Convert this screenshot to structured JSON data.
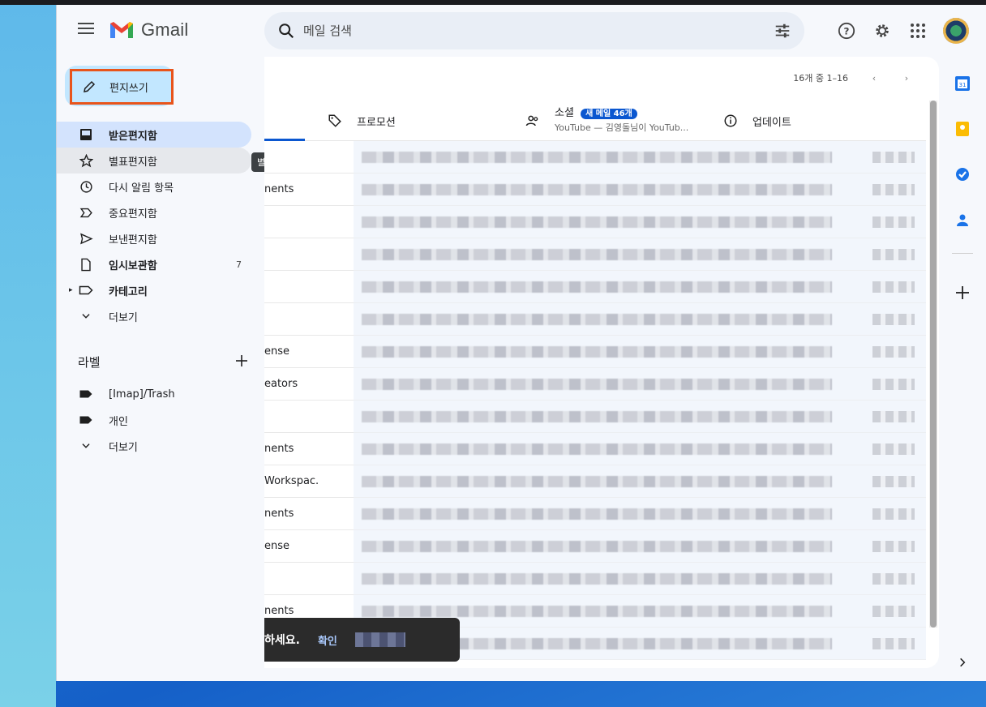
{
  "app": {
    "name": "Gmail",
    "search_placeholder": "메일 검색"
  },
  "compose": {
    "label": "편지쓰기"
  },
  "nav": {
    "items": [
      {
        "label": "받은편지함",
        "icon": "inbox-icon",
        "active": true
      },
      {
        "label": "별표편지함",
        "icon": "star-icon",
        "hover": true
      },
      {
        "label": "다시 알림 항목",
        "icon": "clock-icon"
      },
      {
        "label": "중요편지함",
        "icon": "important-icon"
      },
      {
        "label": "보낸편지함",
        "icon": "send-icon"
      },
      {
        "label": "임시보관함",
        "icon": "draft-icon",
        "count": "7",
        "bold": true
      },
      {
        "label": "카테고리",
        "icon": "label-outline-icon",
        "bold": true
      },
      {
        "label": "더보기",
        "icon": "chevron-down-icon"
      }
    ],
    "tooltip": "별표편지함"
  },
  "labels": {
    "title": "라벨",
    "items": [
      {
        "label": "[Imap]/Trash",
        "icon": "label-icon"
      },
      {
        "label": "개인",
        "icon": "label-icon"
      },
      {
        "label": "더보기",
        "icon": "chevron-down-icon"
      }
    ]
  },
  "pager": {
    "text": "16개 중 1–16"
  },
  "tabs": [
    {
      "label": "프로모션",
      "icon": "tag-icon"
    },
    {
      "label": "소셜",
      "icon": "people-icon",
      "badge": "새 메일 46개",
      "sub": "YouTube — 김영돌님이 YouTub..."
    },
    {
      "label": "업데이트",
      "icon": "info-icon"
    }
  ],
  "rows": [
    {
      "sender": ""
    },
    {
      "sender": "nents"
    },
    {
      "sender": ""
    },
    {
      "sender": ""
    },
    {
      "sender": ""
    },
    {
      "sender": ""
    },
    {
      "sender": "ense"
    },
    {
      "sender": "eators"
    },
    {
      "sender": ""
    },
    {
      "sender": "nents"
    },
    {
      "sender": "Workspac."
    },
    {
      "sender": "nents"
    },
    {
      "sender": "ense"
    },
    {
      "sender": ""
    },
    {
      "sender": "nents"
    },
    {
      "sender": ""
    }
  ],
  "snackbar": {
    "message": "하세요.",
    "action": "확인"
  },
  "colors": {
    "accent": "#0b57d0",
    "compose_bg": "#c2e7ff",
    "active_nav": "#d3e3fd",
    "highlight_border": "#e8541b"
  }
}
